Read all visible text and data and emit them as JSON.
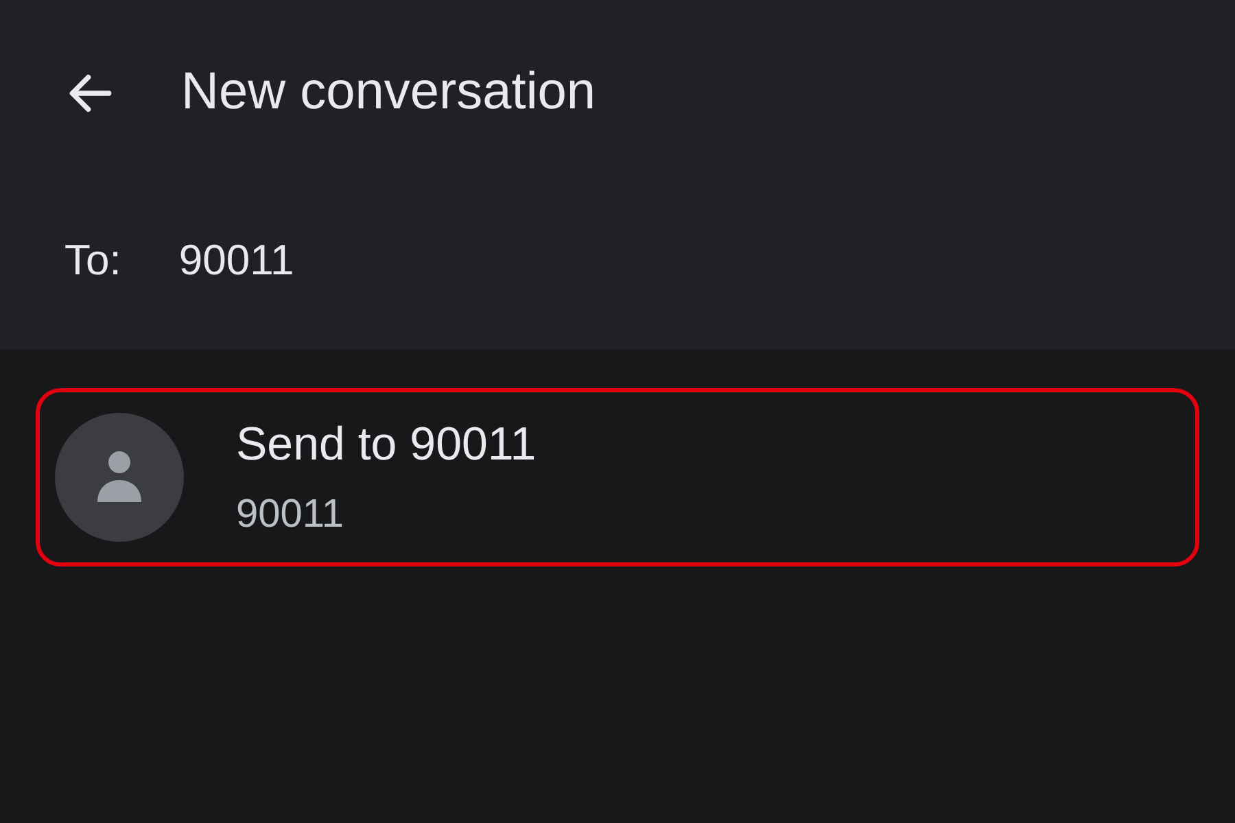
{
  "header": {
    "title": "New conversation"
  },
  "recipient": {
    "label": "To:",
    "value": "90011"
  },
  "suggestions": [
    {
      "title": "Send to 90011",
      "subtitle": "90011",
      "highlighted": true
    }
  ]
}
